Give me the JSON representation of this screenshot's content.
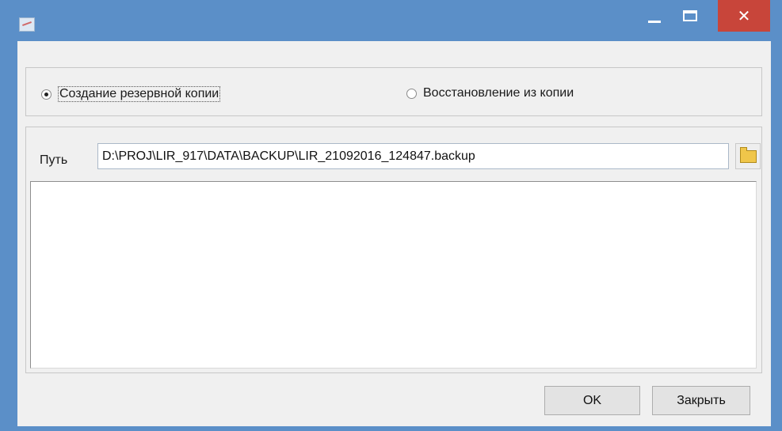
{
  "window": {
    "title": "",
    "controls": {
      "minimize": "minimize-icon",
      "maximize": "maximize-icon",
      "close_glyph": "✕"
    }
  },
  "mode": {
    "backup_label": "Создание резервной копии",
    "restore_label": "Восстановление из копии",
    "selected": "backup"
  },
  "path": {
    "label": "Путь",
    "value": "D:\\PROJ\\LIR_917\\DATA\\BACKUP\\LIR_21092016_124847.backup",
    "browse_icon": "folder-icon"
  },
  "log": {
    "text": ""
  },
  "buttons": {
    "ok_label": "OK",
    "close_label": "Закрыть"
  },
  "colors": {
    "titlebar": "#5b8fc8",
    "close": "#c8453a",
    "client": "#f0f0f0"
  }
}
